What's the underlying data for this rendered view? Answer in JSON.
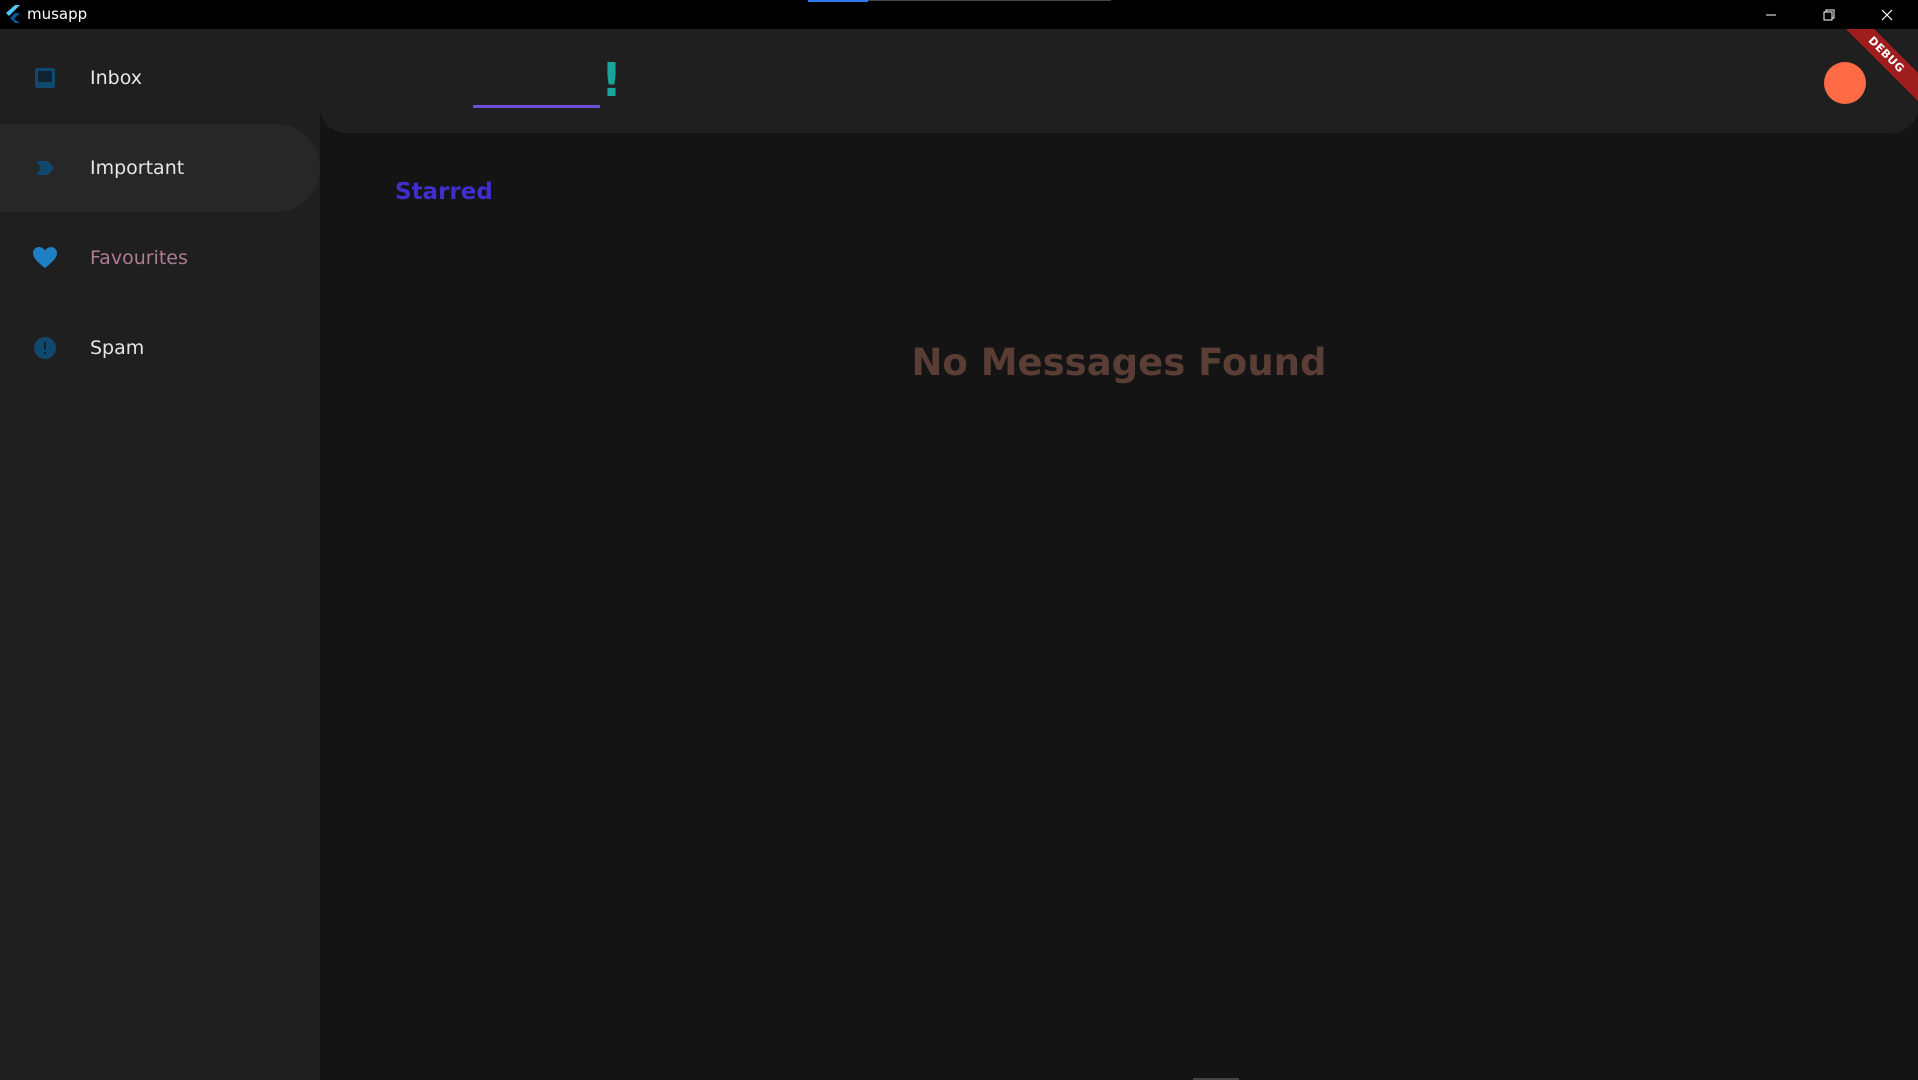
{
  "window": {
    "title": "musapp"
  },
  "sidebar": {
    "items": [
      {
        "label": "Inbox",
        "icon": "inbox-icon"
      },
      {
        "label": "Important",
        "icon": "label-important-icon",
        "selected": true
      },
      {
        "label": "Favourites",
        "icon": "heart-icon"
      },
      {
        "label": "Spam",
        "icon": "error-icon"
      }
    ]
  },
  "header": {
    "brand_mark": "!",
    "debug_badge": "DEBUG"
  },
  "main": {
    "section_title": "Starred",
    "empty_message": "No Messages Found"
  },
  "colors": {
    "sidebar_bg": "#1f1f1f",
    "main_bg": "#141414",
    "accent_purple": "#3f2fd0",
    "accent_teal": "#1aa39b",
    "avatar": "#ff6b45",
    "icon_blue": "#1f7fc4",
    "empty_text": "#5a3d35"
  }
}
